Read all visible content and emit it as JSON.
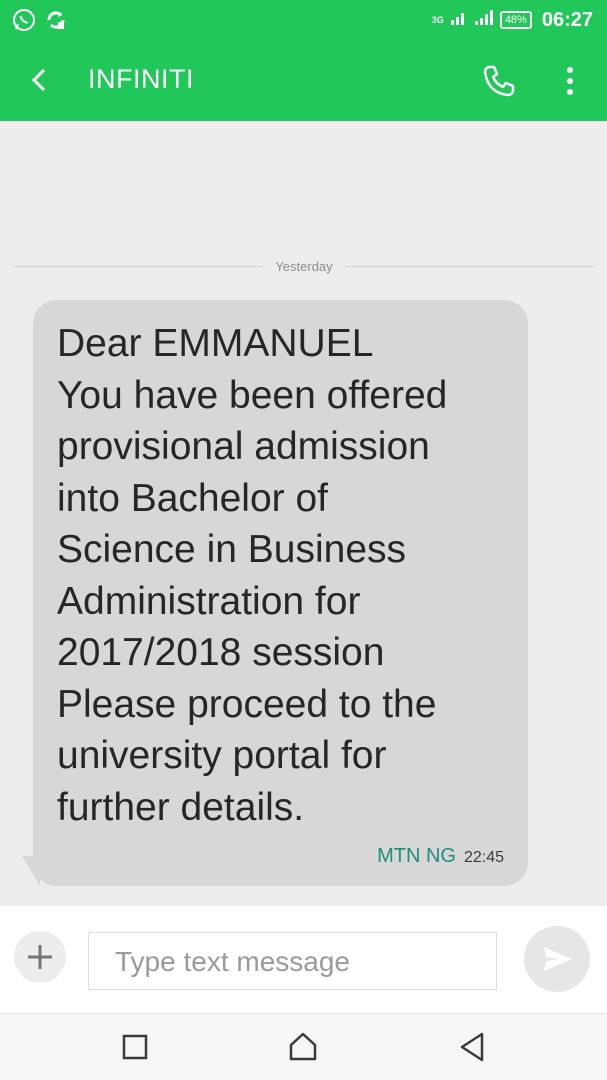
{
  "status_bar": {
    "network": "3G",
    "battery": "48%",
    "time": "06:27",
    "icons": [
      "whatsapp-icon",
      "sync-icon",
      "signal-icon",
      "signal-icon-2",
      "battery-icon"
    ]
  },
  "toolbar": {
    "title": "INFINITI",
    "icons": [
      "back-arrow-icon",
      "phone-icon",
      "more-vert-icon"
    ]
  },
  "conversation": {
    "date_label": "Yesterday",
    "message": {
      "lines": [
        "Dear EMMANUEL",
        "You have been offered",
        "provisional admission",
        "into Bachelor of",
        "Science in Business",
        "Administration for",
        "2017/2018 session",
        "Please proceed to the",
        "university portal for",
        "further details."
      ],
      "carrier": "MTN NG",
      "time": "22:45"
    }
  },
  "compose": {
    "placeholder": "Type text message",
    "icons": [
      "add-icon",
      "send-icon"
    ]
  },
  "navbar": {
    "icons": [
      "recent-apps-icon",
      "home-icon",
      "back-icon"
    ]
  },
  "colors": {
    "accent": "#22c75a",
    "bubble": "#d7d7d9",
    "carrier_text": "#1f8f79"
  }
}
